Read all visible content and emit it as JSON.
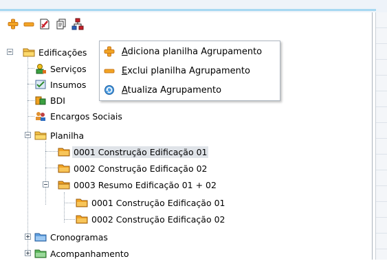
{
  "toolbar": {
    "buttons": [
      "add-icon",
      "remove-icon",
      "edit-icon",
      "copy-icon",
      "group-icon"
    ],
    "colors": {
      "add": "#f2a424",
      "remove": "#f2a424",
      "edit": "#c8202a",
      "group": "#c8202a"
    }
  },
  "tree": {
    "root_label": "Edificações",
    "servicos_label": "Serviços",
    "insumos_label": "Insumos",
    "bdi_label": "BDI",
    "encargos_label": "Encargos Sociais",
    "planilha_label": "Planilha",
    "p1_label": "0001 Construção  Edificação 01",
    "p2_label": "0002 Construção Edificação 02",
    "p3_label": "0003 Resumo Edificação 01 + 02",
    "p3_1_label": "0001 Construção  Edificação 01",
    "p3_2_label": "0002 Construção Edificação 02",
    "cronogramas_label": "Cronogramas",
    "acompanhamento_label": "Acompanhamento"
  },
  "context_menu": {
    "add_first": "A",
    "add_rest": "diciona planilha Agrupamento",
    "remove_first": "E",
    "remove_rest": "xclui planilha Agrupamento",
    "update_first": "A",
    "update_rest": "tualiza Agrupamento"
  }
}
